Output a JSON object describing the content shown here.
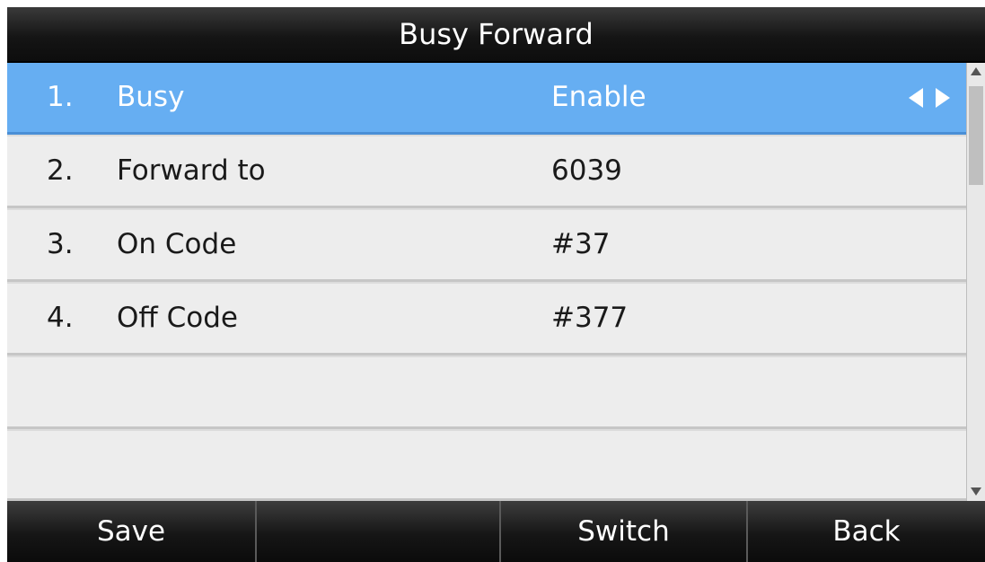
{
  "title": "Busy Forward",
  "items": [
    {
      "num": "1.",
      "label": "Busy",
      "value": "Enable",
      "selected": true
    },
    {
      "num": "2.",
      "label": "Forward to",
      "value": "6039",
      "selected": false
    },
    {
      "num": "3.",
      "label": "On Code",
      "value": "#37",
      "selected": false
    },
    {
      "num": "4.",
      "label": "Off Code",
      "value": "#377",
      "selected": false
    },
    {
      "num": "",
      "label": "",
      "value": "",
      "selected": false
    },
    {
      "num": "",
      "label": "",
      "value": "",
      "selected": false
    }
  ],
  "softkeys": [
    "Save",
    "",
    "Switch",
    "Back"
  ],
  "icons": {
    "selector_left": "triangle-left-icon",
    "selector_right": "triangle-right-icon",
    "scroll_up": "scroll-up-arrow-icon",
    "scroll_down": "scroll-down-arrow-icon"
  },
  "colors": {
    "selected_row": "#66aef2",
    "row": "#ededed",
    "bar": "#151515"
  }
}
